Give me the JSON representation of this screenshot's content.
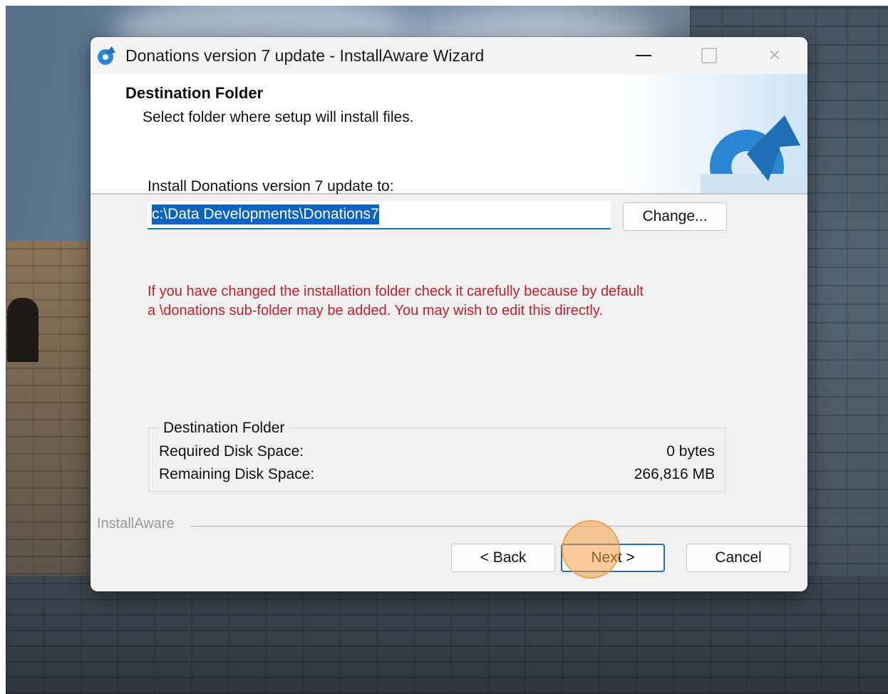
{
  "window": {
    "title": "Donations version 7 update - InstallAware Wizard",
    "icon": "installaware-app-icon"
  },
  "header": {
    "title": "Destination Folder",
    "subtitle": "Select folder where setup will install files."
  },
  "install": {
    "label": "Install Donations version 7 update to:",
    "path_value": "c:\\Data Developments\\Donations7",
    "change_label": "Change..."
  },
  "warning": {
    "line1": "If you have changed the installation folder check it carefully because by default",
    "line2": "a \\donations sub-folder may be added. You may wish to edit this directly.",
    "color": "#c0202a"
  },
  "disk": {
    "group_title": "Destination Folder",
    "required_label": "Required Disk Space:",
    "required_value": "0 bytes",
    "remaining_label": "Remaining Disk Space:",
    "remaining_value": "266,816 MB"
  },
  "footer": {
    "brand": "InstallAware",
    "back_label": "< Back",
    "next_label": "Next >",
    "cancel_label": "Cancel"
  },
  "colors": {
    "accent": "#1f6fb5",
    "selection": "#0b64c3",
    "click_marker": "#f7a046"
  }
}
